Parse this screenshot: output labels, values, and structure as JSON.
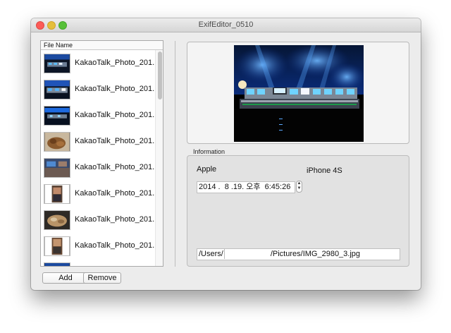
{
  "window": {
    "title": "ExifEditor_0510"
  },
  "file_list": {
    "header": "File Name",
    "items": [
      {
        "label": "KakaoTalk_Photo_201...",
        "thumbnail": "stage-photo"
      },
      {
        "label": "KakaoTalk_Photo_201...",
        "thumbnail": "stage-photo"
      },
      {
        "label": "KakaoTalk_Photo_201...",
        "thumbnail": "stage-photo"
      },
      {
        "label": "KakaoTalk_Photo_201...",
        "thumbnail": "food-photo"
      },
      {
        "label": "KakaoTalk_Photo_201...",
        "thumbnail": "crowd-photo"
      },
      {
        "label": "KakaoTalk_Photo_201...",
        "thumbnail": "portrait-photo"
      },
      {
        "label": "KakaoTalk_Photo_201...",
        "thumbnail": "food-photo"
      },
      {
        "label": "KakaoTalk_Photo_201...",
        "thumbnail": "portrait-photo"
      }
    ]
  },
  "buttons": {
    "add": "Add",
    "remove": "Remove"
  },
  "information": {
    "title": "Information",
    "make": "Apple",
    "model": "iPhone 4S",
    "datetime": "2014 .  8 .19. 오후  6:45:26",
    "path_prefix": "/Users/",
    "path_suffix": "/Pictures/IMG_2980_3.jpg"
  },
  "colors": {
    "close": "#fc5b57",
    "minimize": "#e5bf3c",
    "maximize": "#57c038",
    "window_bg": "#ececec",
    "stage_blue": "#1b5fd6"
  }
}
